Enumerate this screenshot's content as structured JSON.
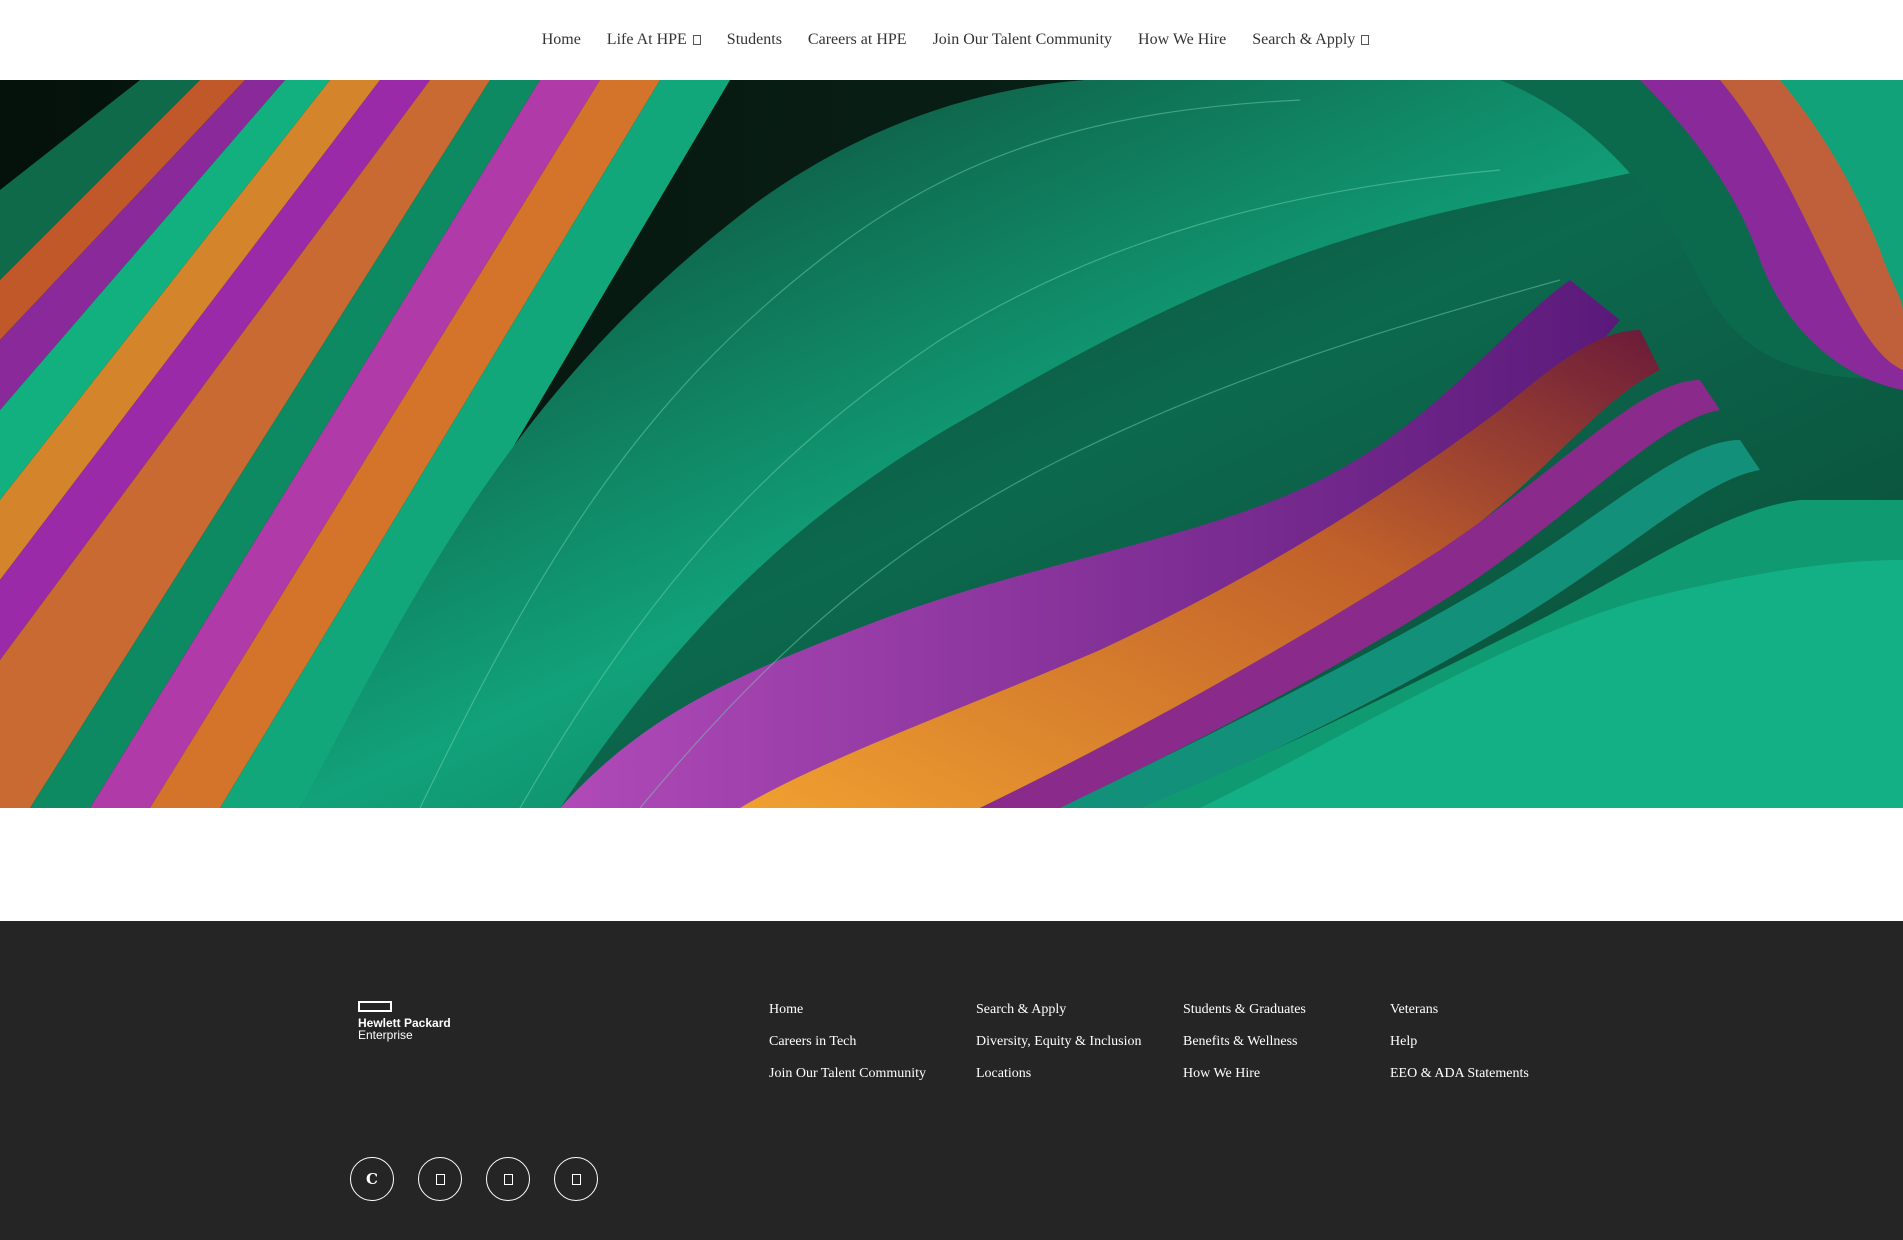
{
  "nav": {
    "items": [
      {
        "label": "Home",
        "dropdown": false
      },
      {
        "label": "Life At HPE",
        "dropdown": true
      },
      {
        "label": "Students",
        "dropdown": false
      },
      {
        "label": "Careers at HPE",
        "dropdown": false
      },
      {
        "label": "Join Our Talent Community",
        "dropdown": false
      },
      {
        "label": "How We Hire",
        "dropdown": false
      },
      {
        "label": "Search & Apply",
        "dropdown": true
      }
    ]
  },
  "hero": {
    "colors": {
      "green": "#11a27a",
      "purple": "#7a2a9a",
      "orange": "#d4842a",
      "dark": "#0a1a12"
    }
  },
  "footer": {
    "logo": {
      "line1": "Hewlett Packard",
      "line2": "Enterprise"
    },
    "columns": [
      {
        "links": [
          "Home",
          "Careers in Tech",
          "Join Our Talent Community"
        ]
      },
      {
        "links": [
          "Search & Apply",
          "Diversity, Equity & Inclusion",
          "Locations"
        ]
      },
      {
        "links": [
          "Students & Graduates",
          "Benefits & Wellness",
          "How We Hire"
        ]
      },
      {
        "links": [
          "Veterans",
          "Help",
          "EEO & ADA Statements"
        ]
      }
    ],
    "socials": [
      {
        "icon": "c-social-icon",
        "glyph": "C"
      },
      {
        "icon": "social-icon-2",
        "glyph": ""
      },
      {
        "icon": "social-icon-3",
        "glyph": ""
      },
      {
        "icon": "social-icon-4",
        "glyph": ""
      }
    ],
    "background": "#252525"
  }
}
